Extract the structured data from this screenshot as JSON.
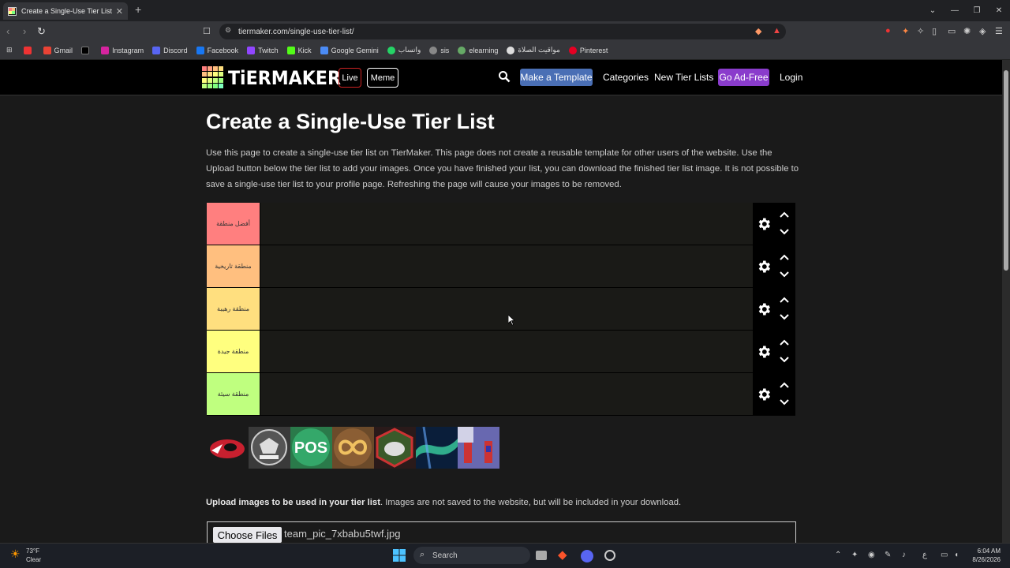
{
  "browser": {
    "tab_title": "Create a Single-Use Tier List (Pri",
    "url": "tiermaker.com/single-use-tier-list/",
    "bookmarks": [
      "Gmail",
      "Instagram",
      "Discord",
      "Facebook",
      "Twitch",
      "Kick",
      "Google Gemini",
      "واتساب",
      "sis",
      "elearning",
      "مواقيت الصلاة",
      "Pinterest"
    ]
  },
  "header": {
    "logo": "TiERMAKER",
    "live": "Live",
    "meme": "Meme",
    "make_template": "Make a Template",
    "categories": "Categories",
    "new_tier_lists": "New Tier Lists",
    "go_ad_free": "Go Ad-Free",
    "login": "Login"
  },
  "page": {
    "title": "Create a Single-Use Tier List",
    "intro": "Use this page to create a single-use tier list on TierMaker. This page does not create a reusable template for other users of the website. Use the Upload button below the tier list to add your images. Once you have finished your list, you can download the finished tier list image. It is not possible to save a single-use tier list to your profile page. Refreshing the page will cause your images to be removed."
  },
  "tiers": [
    {
      "label": "أفضل منطقة",
      "color": "#ff7f7f"
    },
    {
      "label": "منطقة تاريخية",
      "color": "#ffbf7f"
    },
    {
      "label": "منطقة رهيبة",
      "color": "#ffdf7f"
    },
    {
      "label": "منطقة جيدة",
      "color": "#ffff7f"
    },
    {
      "label": "منطقة سيئة",
      "color": "#bfff7f"
    }
  ],
  "upload": {
    "bold": "Upload images to be used in your tier list",
    "rest": ". Images are not saved to the website, but will be included in your download.",
    "choose_files": "Choose Files",
    "file_name": "team_pic_7xbabu5twf.jpg"
  },
  "taskbar": {
    "temp": "73°F",
    "condition": "Clear",
    "search": "Search",
    "time": "6:04 AM",
    "date": "8/26/2026",
    "lang": "ع"
  }
}
